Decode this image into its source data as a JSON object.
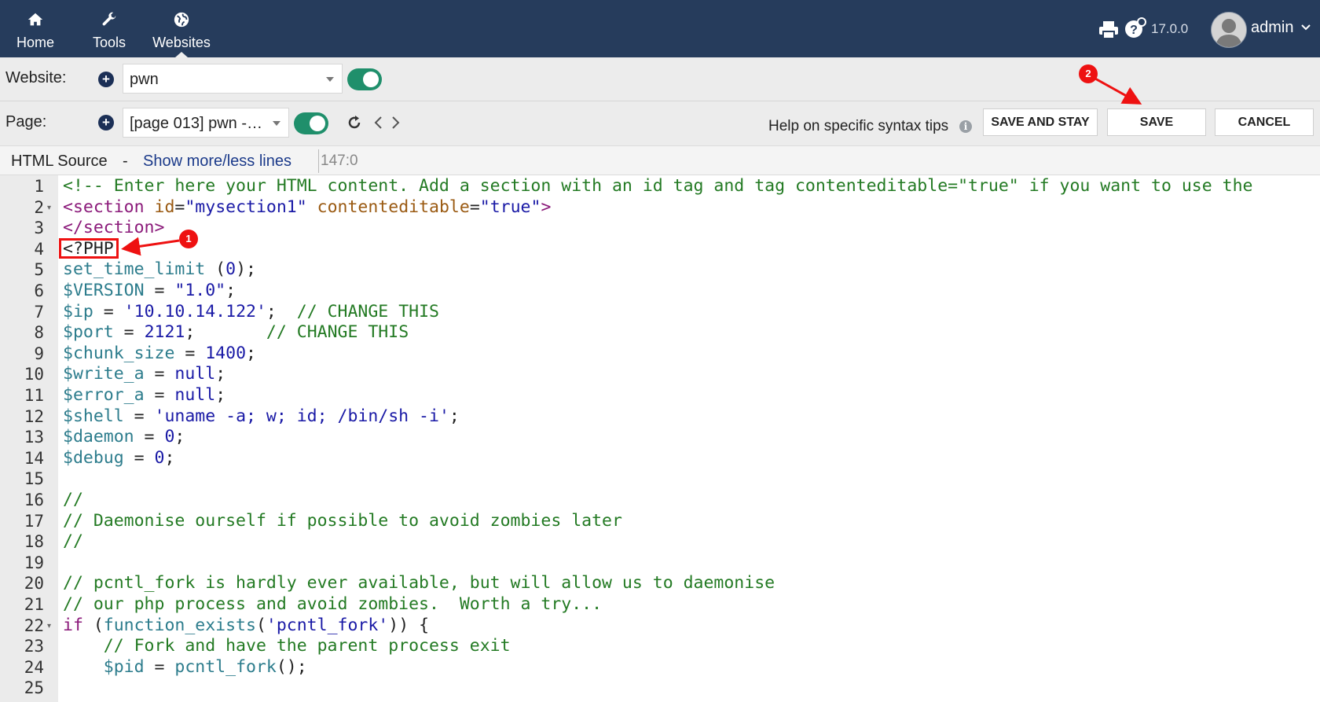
{
  "nav": {
    "items": [
      {
        "label": "Home",
        "icon": "home-icon"
      },
      {
        "label": "Tools",
        "icon": "wrench-icon"
      },
      {
        "label": "Websites",
        "icon": "globe-icon"
      }
    ],
    "version": "17.0.0",
    "user": "admin",
    "colors": {
      "bar": "#263c5c"
    }
  },
  "toolbar": {
    "website_label": "Website:",
    "website_value": "pwn",
    "page_label": "Page:",
    "page_value": "[page 013] pwn - …",
    "help_text": "Help on specific syntax tips",
    "save_and_stay": "SAVE AND STAY",
    "save": "SAVE",
    "cancel": "CANCEL"
  },
  "source": {
    "title": "HTML Source",
    "dash": "-",
    "toggle_lines_link": "Show more/less lines",
    "cursor_position": "147:0"
  },
  "editor": {
    "line_numbers": [
      "1",
      "2",
      "3",
      "4",
      "5",
      "6",
      "7",
      "8",
      "9",
      "10",
      "11",
      "12",
      "13",
      "14",
      "15",
      "16",
      "17",
      "18",
      "19",
      "20",
      "21",
      "22",
      "23",
      "24",
      "25"
    ],
    "folded_lines": [
      "2",
      "22"
    ]
  },
  "annotations": {
    "badge1": "1",
    "badge2": "2",
    "arrow_color": "#e11111"
  }
}
